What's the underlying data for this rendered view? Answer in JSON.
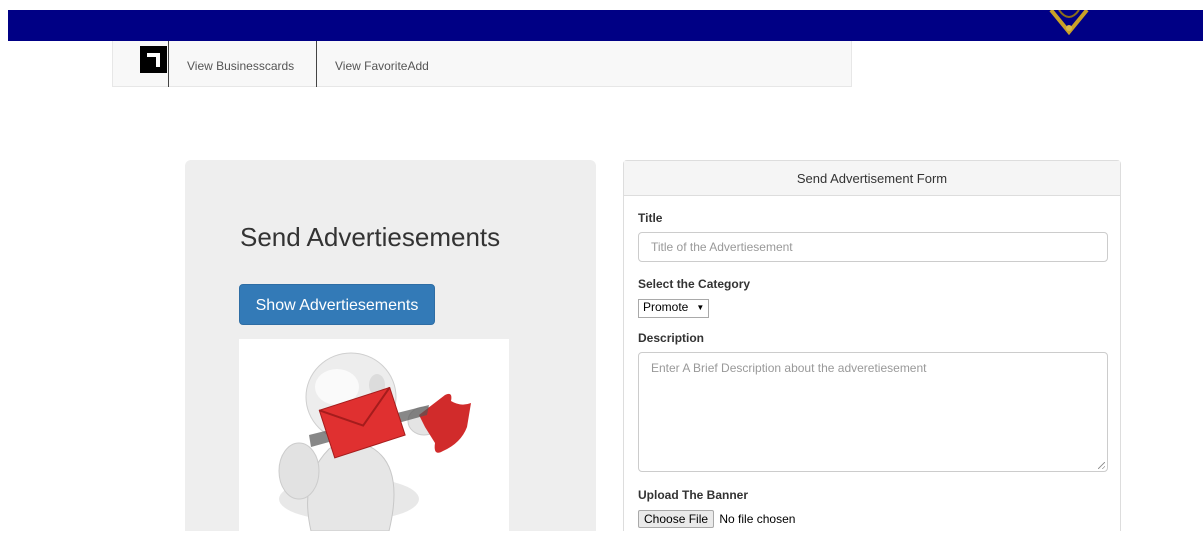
{
  "nav": {
    "brand_icon": "square-logo-icon",
    "items": [
      {
        "label": "View Businesscards"
      },
      {
        "label": "View FavoriteAdd"
      }
    ]
  },
  "hero": {
    "title": "Send Advertiesements",
    "button_label": "Show Advertiesements",
    "illustration": "slingshot-envelope-figure-image"
  },
  "form": {
    "heading": "Send Advertisement Form",
    "title_label": "Title",
    "title_placeholder": "Title of the Advertiesement",
    "category_label": "Select the Category",
    "category_selected": "Promote",
    "description_label": "Description",
    "description_placeholder": "Enter A Brief Description about the adveretiesement",
    "banner_label": "Upload The Banner",
    "file_button": "Choose File",
    "file_status": "No file chosen"
  },
  "colors": {
    "topbar": "#000085",
    "primary_button": "#337ab7",
    "hero_background": "#eeeeee"
  }
}
